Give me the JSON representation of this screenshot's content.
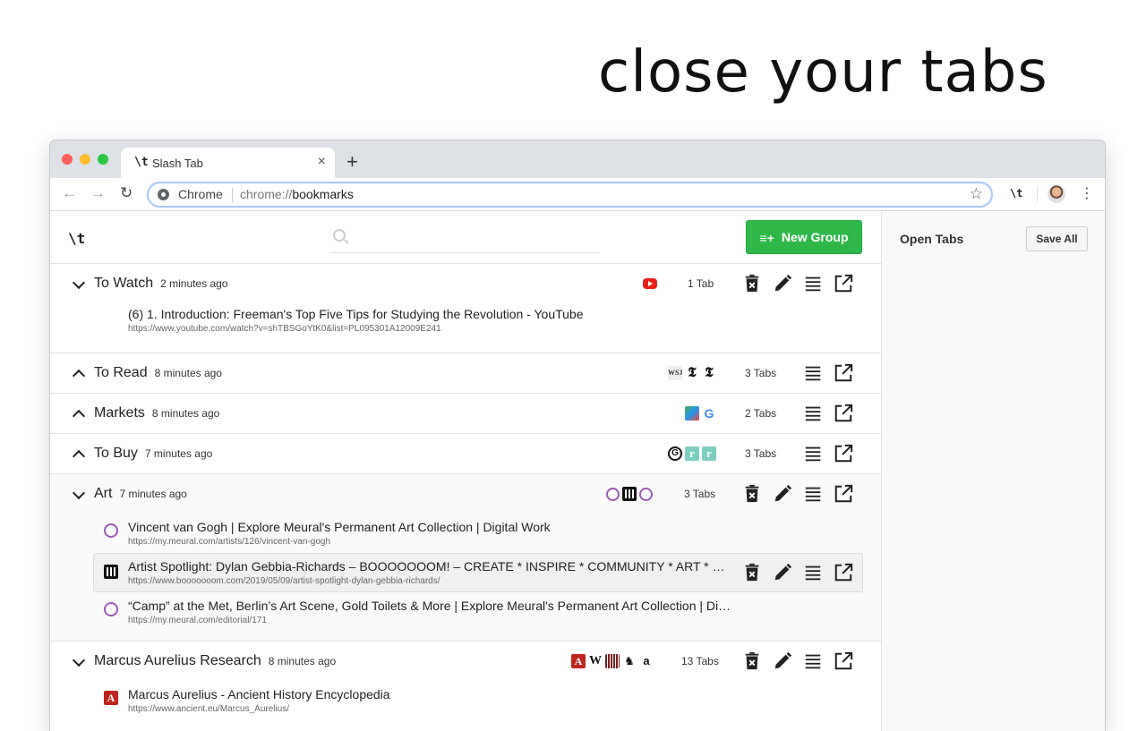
{
  "headline": "close your tabs",
  "browser": {
    "tab_title": "Slash Tab",
    "tab_favicon": "\\t",
    "tab_close": "×",
    "new_tab": "+",
    "omni_label": "Chrome",
    "omni_url_dim": "chrome://",
    "omni_url_path": "bookmarks",
    "extension_label": "\\t"
  },
  "app": {
    "logo": "\\t",
    "search_placeholder": "",
    "new_group_label": "New Group"
  },
  "sidebar": {
    "title": "Open Tabs",
    "save_all_label": "Save All"
  },
  "groups": [
    {
      "title": "To Watch",
      "time": "2 minutes ago",
      "count": "1 Tab",
      "expanded": true,
      "favicons": [
        "youtube-icon"
      ],
      "tabs": [
        {
          "title": "(6) 1. Introduction: Freeman's Top Five Tips for Studying the Revolution - YouTube",
          "url": "https://www.youtube.com/watch?v=shTBSGoYtK0&list=PL095301A12009E241",
          "favicon": "youtube-icon"
        }
      ]
    },
    {
      "title": "To Read",
      "time": "8 minutes ago",
      "count": "3 Tabs",
      "expanded": false,
      "favicons": [
        "wsj-icon",
        "nytimes-icon",
        "nytimes-icon"
      ]
    },
    {
      "title": "Markets",
      "time": "8 minutes ago",
      "count": "2 Tabs",
      "expanded": false,
      "favicons": [
        "chart-icon",
        "google-icon"
      ]
    },
    {
      "title": "To Buy",
      "time": "7 minutes ago",
      "count": "3 Tabs",
      "expanded": false,
      "favicons": [
        "gumroad-icon",
        "rr-icon",
        "rr-icon"
      ]
    },
    {
      "title": "Art",
      "time": "7 minutes ago",
      "count": "3 Tabs",
      "expanded": true,
      "favicons": [
        "meural-icon",
        "boooooom-icon",
        "meural-icon"
      ],
      "tabs": [
        {
          "title": "Vincent van Gogh | Explore Meural's Permanent Art Collection | Digital Work",
          "url": "https://my.meural.com/artists/126/vincent-van-gogh",
          "favicon": "meural-icon"
        },
        {
          "title": "Artist Spotlight: Dylan Gebbia-Richards – BOOOOOOOM! – CREATE * INSPIRE * COMMUNITY * ART * DESIGN * MUSIC * FILM * PHOTO",
          "url": "https://www.booooooom.com/2019/05/09/artist-spotlight-dylan-gebbia-richards/",
          "favicon": "boooooom-icon"
        },
        {
          "title": "“Camp” at the Met, Berlin’s Art Scene, Gold Toilets & More | Explore Meural's Permanent Art Collection | Digital Work",
          "url": "https://my.meural.com/editorial/171",
          "favicon": "meural-icon"
        }
      ]
    },
    {
      "title": "Marcus Aurelius Research",
      "time": "8 minutes ago",
      "count": "13 Tabs",
      "expanded": true,
      "favicons": [
        "ancient-icon",
        "wikipedia-icon",
        "library-icon",
        "horse-icon",
        "amazon-icon"
      ],
      "tabs": [
        {
          "title": "Marcus Aurelius - Ancient History Encyclopedia",
          "url": "https://www.ancient.eu/Marcus_Aurelius/",
          "favicon": "ancient-icon"
        }
      ]
    }
  ],
  "colors": {
    "new_group_bg": "#2fb84a",
    "youtube": "#e62117",
    "meural": "#9b59b6"
  }
}
